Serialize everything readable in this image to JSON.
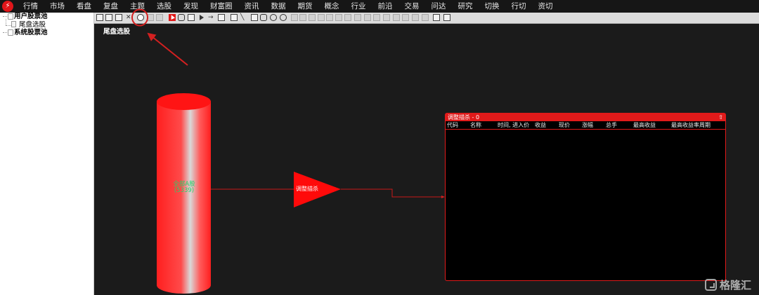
{
  "menu": {
    "logo": "logo-icon",
    "items": [
      "行情",
      "市场",
      "看盘",
      "复盘",
      "主题",
      "选股",
      "发现",
      "财富圈",
      "资讯",
      "数据",
      "期货",
      "概念",
      "行业",
      "前沿",
      "交易",
      "问达",
      "研究",
      "切换",
      "行切",
      "资切"
    ]
  },
  "sidebar": {
    "groups": [
      {
        "label": "用户股票池",
        "children": [
          "尾盘选股"
        ]
      },
      {
        "label": "系统股票池",
        "children": []
      }
    ]
  },
  "toolbar": {
    "icons": [
      "new-file-icon",
      "open-folder-icon",
      "save-icon",
      "close-icon",
      "clock-icon",
      "disabled-icon-1",
      "disabled-icon-2",
      "pointer-icon",
      "rounded-rect-icon",
      "document-icon",
      "play-icon",
      "arrow-right-icon",
      "condition-icon",
      "filter-icon",
      "line-icon",
      "rect-icon",
      "rounded-square-icon",
      "ellipse-icon",
      "circle-icon",
      "align-left-icon",
      "align-center-icon",
      "align-right-icon",
      "align-top-icon",
      "align-middle-icon",
      "align-bottom-icon",
      "dist-h-icon",
      "dist-v-icon",
      "size-width-icon",
      "size-height-icon",
      "size-both-icon",
      "bring-front-icon",
      "send-back-icon",
      "group-icon",
      "ungroup-icon",
      "lock-icon",
      "grid-icon"
    ]
  },
  "canvas": {
    "title": "尾盘选股",
    "cylinder": {
      "label": "全部A股",
      "sublabel": "(5339)"
    },
    "triangle": {
      "label": "调整描杀"
    }
  },
  "panel": {
    "title": "调整描杀 - 0",
    "up_icon": "up-arrow-icon",
    "columns": [
      "代码",
      "名称",
      "时间, 进入价",
      "收益",
      "现价",
      "涨幅",
      "总手",
      "最高收益",
      "最高收益率周期"
    ]
  },
  "watermark": {
    "text": "格隆汇"
  },
  "colors": {
    "accent": "#e01a1a",
    "background": "#1b1b1b",
    "annotation": "#d42020"
  }
}
